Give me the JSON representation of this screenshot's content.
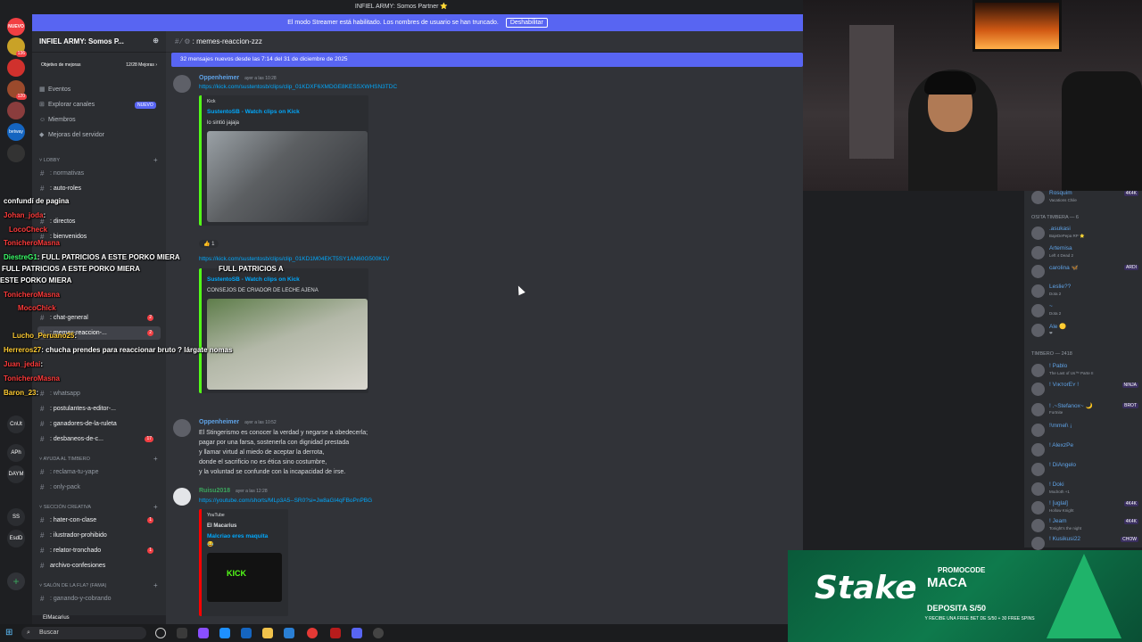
{
  "window": {
    "title": "INFIEL ARMY: Somos Partner ⭐"
  },
  "streamer_banner": {
    "text": "El modo Streamer está habilitado. Los nombres de usuario se han truncado.",
    "button": "Deshabilitar"
  },
  "rail": {
    "servers": [
      {
        "label": "NUEVO",
        "badge": ""
      },
      {
        "label": "",
        "badge": "136"
      },
      {
        "label": "",
        "badge": ""
      },
      {
        "label": "",
        "badge": "120"
      },
      {
        "label": "",
        "badge": ""
      },
      {
        "label": "betway",
        "badge": ""
      },
      {
        "label": "",
        "badge": ""
      }
    ],
    "names": [
      "CnUt",
      "APh",
      "DAYM",
      "SS",
      "EsdD"
    ]
  },
  "sidebar": {
    "server_name": "INFIEL ARMY: Somos P...",
    "goal": {
      "label": "Objetivo de mejoras",
      "value": "12/28 Mejoras",
      "arrow": "›"
    },
    "menu": [
      {
        "label": "Eventos",
        "icon": "▦"
      },
      {
        "label": "Explorar canales",
        "icon": "⊞",
        "badge": "NUEVO"
      },
      {
        "label": "Miembros",
        "icon": "☺"
      },
      {
        "label": "Mejoras del servidor",
        "icon": "◆"
      }
    ],
    "categories": {
      "lobby": "LOBBY",
      "ayuda": "AYUDA AL TIMBERO",
      "creativa": "SECCIÓN CREATIVA",
      "salon": "SALÓN DE LA FLA? (FAMA)"
    },
    "channels": [
      {
        "label": ": normativas"
      },
      {
        "label": ": auto-roles"
      },
      {
        "label": ": directos"
      },
      {
        "label": ": bienvenidos"
      },
      {
        "label": ": chat-general",
        "count": "2"
      },
      {
        "label": ": memes-reaccion-...",
        "count": "2"
      },
      {
        "label": ": whatsapp"
      },
      {
        "label": ": postulantes-a-editor-..."
      },
      {
        "label": ": ganadores-de-la-ruleta"
      },
      {
        "label": ": desbaneos-de-c...",
        "count": "17"
      },
      {
        "label": ": reclama-tu-yape"
      },
      {
        "label": ": only-pack"
      },
      {
        "label": ": hater-con-clase",
        "count": "1"
      },
      {
        "label": ": ilustrador-prohibido"
      },
      {
        "label": ": relator-tronchado",
        "count": "1"
      },
      {
        "label": "archivo-confesiones"
      },
      {
        "label": ": ganando-y-cobrando"
      }
    ],
    "user": "ElMacarius"
  },
  "channel": {
    "name": ": memes-reaccion-zzz",
    "new_messages": "32 mensajes nuevos desde las 7:14 del 31 de diciembre de 2025"
  },
  "messages": {
    "m1": {
      "author": "Oppenheimer",
      "time": "ayer a las 10:28",
      "link": "https://kick.com/sustentosb/clips/clip_01KDXF6XMDGE8KESSXWHSN3TDC",
      "embed": {
        "provider": "Kick",
        "title": "SustentoSB - Watch clips on Kick",
        "desc": "lo sintió jajaja"
      },
      "reaction_count": "1"
    },
    "m2": {
      "link": "https://kick.com/sustentosb/clips/clip_01KD1M04EKT5SY1AN60G500K1V",
      "embed": {
        "title": "SustentoSB - Watch clips on Kick",
        "desc": "CONSEJOS DE CRIADOR DE LECHE AJENA"
      }
    },
    "m3": {
      "author": "Oppenheimer",
      "time": "ayer a las 10:52",
      "lines": [
        "El Stingerismo es conocer la verdad y negarse a obedecerla;",
        "pagar por una farsa, sostenerla con dignidad prestada",
        "y llamar virtud al miedo de aceptar la derrota,",
        "donde el sacrificio no es ética sino costumbre,",
        "y la voluntad se confunde con la incapacidad de irse."
      ]
    },
    "m4": {
      "author": "Ruisu2018",
      "time": "ayer a las 12:28",
      "link": "https://youtube.com/shorts/MLp3A5--SR0?si=Jw8aGI4qFBoPnPBG",
      "embed": {
        "provider": "YouTube",
        "author": "El Macarius",
        "title": "Malcriao eres maquita",
        "emoji": "😂"
      }
    }
  },
  "overlay": [
    {
      "name": "",
      "text": "confundí de pagina"
    },
    {
      "name": "Johan_joda",
      "text": ":"
    },
    {
      "name": "LocoCheck",
      "text": ""
    },
    {
      "name": "TonicheroMasna",
      "text": ""
    },
    {
      "name": "DiestreG1",
      "text": ": FULL PATRICIOS A ESTE PORKO MIERA"
    },
    {
      "name": "",
      "text": "FULL PATRICIOS A ESTE PORKO MIERA"
    },
    {
      "name": "",
      "text": "FULL PATRICIOS A"
    },
    {
      "name": "",
      "text": "ESTE PORKO MIERA"
    },
    {
      "name": "TonicheroMasna",
      "text": ""
    },
    {
      "name": "MocoChick",
      "text": ""
    },
    {
      "name": "Lucho_Peruano25",
      "text": ":"
    },
    {
      "name": "Herreros27",
      "text": ": chucha prendes para reaccionar bruto ? lárgate nomas"
    },
    {
      "name": "Juan_jedai",
      "text": ":"
    },
    {
      "name": "TonicheroMasna",
      "text": ""
    },
    {
      "name": "Baron_23",
      "text": ":"
    }
  ],
  "members": {
    "cat1": "OSITA TIMBERA — 6",
    "cat2": "TIMBERO — 2418",
    "top": [
      {
        "name": "Rosquim",
        "sub": "Vacations Chile",
        "tag": "4K4K"
      }
    ],
    "group1": [
      {
        "name": ".asukasi",
        "sub": "BajeDePepa RP ⭐"
      },
      {
        "name": "Artemisa",
        "sub": "Left 4 Dead 2"
      },
      {
        "name": "carolina 🦋",
        "sub": "",
        "tag": "ARDI"
      },
      {
        "name": "Leslie??",
        "sub": "Dota 2"
      },
      {
        "name": "~",
        "sub": "Dota 2"
      },
      {
        "name": "Ale 🟡",
        "sub": "❤"
      }
    ],
    "group2": [
      {
        "name": "! Pablo",
        "sub": "The Last of Us™ Parte II"
      },
      {
        "name": "! VıĸтorEʏ !",
        "sub": "",
        "tag": "NINJA"
      },
      {
        "name": "! .~Stefanox~ 🌙",
        "sub": "Fortnite",
        "tag": "BROT"
      },
      {
        "name": "!\\mmel\\ ¡",
        "sub": ""
      },
      {
        "name": "! AlexzPe",
        "sub": ""
      },
      {
        "name": "! DiAngelo",
        "sub": ""
      },
      {
        "name": "! Doki",
        "sub": "Modroth +1"
      },
      {
        "name": "! [uglal]",
        "sub": "Hollow Knight",
        "tag": "4K4K"
      },
      {
        "name": "! Jeam",
        "sub": "Tonight's the night",
        "tag": "4K4K"
      },
      {
        "name": "! Kusikusi22",
        "sub": "",
        "tag": "CHOW"
      }
    ]
  },
  "stake": {
    "logo": "Stake",
    "promo1": "PROMOCODE",
    "promo2": "MACA",
    "promo3": "DEPOSITA S/50",
    "promo4": "Y RECIBE UNA FREE BET DE S/50 + 30 FREE SPINS"
  },
  "taskbar": {
    "search": "Buscar"
  },
  "colors": {
    "accent": "#5865f2",
    "kick": "#53fc18",
    "stake": "#0e7a4c"
  }
}
